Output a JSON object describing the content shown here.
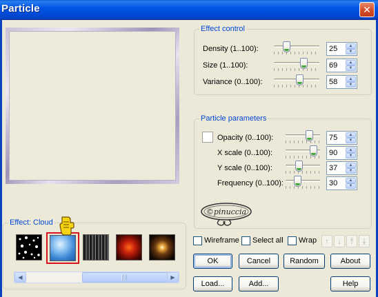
{
  "window": {
    "title": "Particle"
  },
  "effect_control": {
    "title": "Effect control",
    "rows": [
      {
        "label": "Density (1..100):",
        "value": "25",
        "fraction": 0.24
      },
      {
        "label": "Size (1..100):",
        "value": "69",
        "fraction": 0.69
      },
      {
        "label": "Variance (0..100):",
        "value": "58",
        "fraction": 0.58
      }
    ]
  },
  "particle_parameters": {
    "title": "Particle parameters",
    "rows": [
      {
        "label": "Opacity (0..100):",
        "value": "75",
        "fraction": 0.75
      },
      {
        "label": "X scale (0..100):",
        "value": "90",
        "fraction": 0.9
      },
      {
        "label": "Y scale (0..100):",
        "value": "37",
        "fraction": 0.37
      },
      {
        "label": "Frequency (0..100):",
        "value": "30",
        "fraction": 0.3
      }
    ]
  },
  "effect_panel": {
    "title": "Effect: Cloud"
  },
  "options": {
    "wireframe": "Wireframe",
    "select_all": "Select all",
    "wrap": "Wrap"
  },
  "buttons": {
    "ok": "OK",
    "cancel": "Cancel",
    "random": "Random",
    "about": "About",
    "load": "Load...",
    "add": "Add...",
    "help": "Help"
  },
  "watermark": "©pinuccia",
  "colors": {
    "accent": "#0046d5",
    "titlebar": "#0055e5",
    "selection": "#d4131b"
  }
}
